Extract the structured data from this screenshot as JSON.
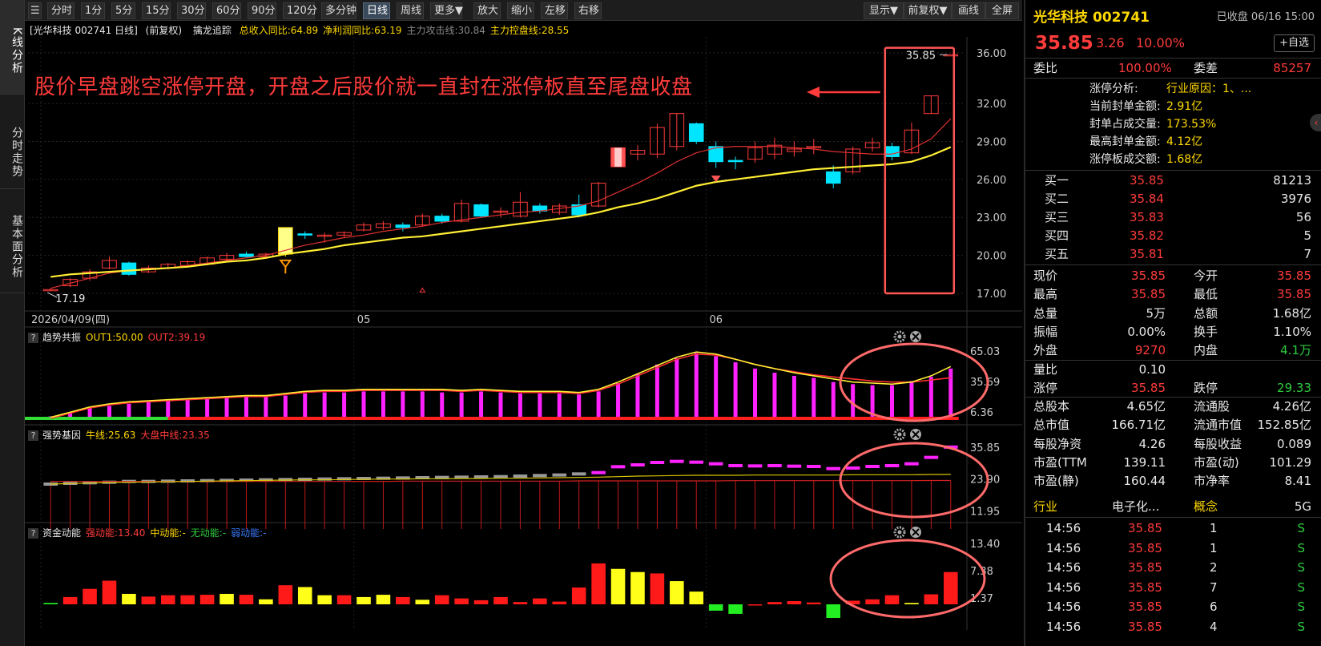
{
  "left_tabs": [
    "K线分析",
    "分时走势",
    "基本面分析"
  ],
  "toolbar": {
    "periods": [
      "分时",
      "1分",
      "5分",
      "15分",
      "30分",
      "60分",
      "90分",
      "120分",
      "多分钟",
      "日线",
      "周线",
      "更多▼"
    ],
    "actions": [
      "放大",
      "缩小",
      "左移",
      "右移"
    ],
    "right_actions": [
      "显示▼",
      "前复权▼",
      "画线",
      "全屏"
    ],
    "active_period": "日线"
  },
  "chart_header": {
    "title": "[光华科技 002741 日线]",
    "adjust": "(前复权)",
    "indicator": "擒龙追踪",
    "items": [
      {
        "label": "总收入同比:64.89",
        "color": "#ffd800"
      },
      {
        "label": "净利润同比:63.19",
        "color": "#ffd800"
      },
      {
        "label": "主力攻击线:30.84",
        "color": "#888888"
      },
      {
        "label": "主力控盘线:28.55",
        "color": "#ffd800"
      }
    ]
  },
  "annotation": "股价早盘跳空涨停开盘，开盘之后股价就一直封在涨停板直至尾盘收盘",
  "main_axis": {
    "ticks": [
      "36.00",
      "32.00",
      "29.00",
      "26.00",
      "23.00",
      "20.00",
      "17.00"
    ],
    "x_labels": [
      "2026/04/09(四)",
      "05",
      "06"
    ],
    "low_label": "17.19",
    "high_label": "35.85"
  },
  "panels": [
    {
      "id": "trend",
      "title": "趋势共振",
      "items": [
        {
          "label": "OUT1:50.00",
          "color": "#ffd800"
        },
        {
          "label": "OUT2:39.19",
          "color": "#ff3b3b"
        }
      ],
      "ticks": [
        "65.03",
        "35.69",
        "6.36"
      ]
    },
    {
      "id": "gene",
      "title": "强势基因",
      "items": [
        {
          "label": "牛线:25.63",
          "color": "#ffd800"
        },
        {
          "label": "大盘中线:23.35",
          "color": "#ff3b3b"
        }
      ],
      "ticks": [
        "35.85",
        "23.90",
        "11.95"
      ]
    },
    {
      "id": "fund",
      "title": "资金动能",
      "items": [
        {
          "label": "强动能:13.40",
          "color": "#ff3b3b"
        },
        {
          "label": "中动能:-",
          "color": "#ffd800"
        },
        {
          "label": "无动能:-",
          "color": "#2ecc40"
        },
        {
          "label": "弱动能:-",
          "color": "#3a7bff"
        }
      ],
      "ticks": [
        "13.40",
        "7.38",
        "1.37"
      ]
    }
  ],
  "chart_data": [
    {
      "type": "candlestick",
      "title": "光华科技 002741 日线",
      "ylim": [
        17,
        36.5
      ],
      "candles": [
        {
          "o": 17.3,
          "c": 17.3,
          "h": 17.4,
          "l": 17.19
        },
        {
          "o": 17.6,
          "c": 18.1,
          "h": 18.2,
          "l": 17.5
        },
        {
          "o": 18.2,
          "c": 18.7,
          "h": 18.9,
          "l": 18.0
        },
        {
          "o": 19.0,
          "c": 19.6,
          "h": 19.9,
          "l": 18.9
        },
        {
          "o": 19.4,
          "c": 18.5,
          "h": 19.5,
          "l": 18.4
        },
        {
          "o": 18.7,
          "c": 19.0,
          "h": 19.2,
          "l": 18.6
        },
        {
          "o": 19.0,
          "c": 19.3,
          "h": 19.4,
          "l": 18.9
        },
        {
          "o": 19.2,
          "c": 19.5,
          "h": 19.6,
          "l": 19.1
        },
        {
          "o": 19.3,
          "c": 19.8,
          "h": 19.9,
          "l": 19.2
        },
        {
          "o": 19.7,
          "c": 20.0,
          "h": 20.2,
          "l": 19.6
        },
        {
          "o": 20.1,
          "c": 19.9,
          "h": 20.3,
          "l": 19.8
        },
        {
          "o": 19.9,
          "c": 20.1,
          "h": 20.2,
          "l": 19.8
        },
        {
          "o": 22.2,
          "c": 20.1,
          "h": 22.2,
          "l": 19.9
        },
        {
          "o": 21.7,
          "c": 21.6,
          "h": 21.9,
          "l": 21.3
        },
        {
          "o": 21.5,
          "c": 21.6,
          "h": 21.8,
          "l": 21.0
        },
        {
          "o": 21.6,
          "c": 21.8,
          "h": 21.9,
          "l": 21.4
        },
        {
          "o": 22.0,
          "c": 22.4,
          "h": 22.6,
          "l": 21.9
        },
        {
          "o": 22.2,
          "c": 22.5,
          "h": 22.7,
          "l": 22.0
        },
        {
          "o": 22.4,
          "c": 22.2,
          "h": 22.6,
          "l": 21.9
        },
        {
          "o": 22.4,
          "c": 23.1,
          "h": 23.3,
          "l": 22.3
        },
        {
          "o": 23.1,
          "c": 22.7,
          "h": 23.3,
          "l": 22.5
        },
        {
          "o": 22.7,
          "c": 24.1,
          "h": 24.4,
          "l": 22.6
        },
        {
          "o": 24.0,
          "c": 23.1,
          "h": 24.1,
          "l": 23.0
        },
        {
          "o": 23.4,
          "c": 23.5,
          "h": 23.8,
          "l": 23.0
        },
        {
          "o": 23.1,
          "c": 24.2,
          "h": 25.0,
          "l": 23.0
        },
        {
          "o": 23.9,
          "c": 23.5,
          "h": 24.1,
          "l": 23.3
        },
        {
          "o": 23.4,
          "c": 23.9,
          "h": 24.1,
          "l": 23.2
        },
        {
          "o": 24.0,
          "c": 23.2,
          "h": 24.8,
          "l": 23.0
        },
        {
          "o": 23.9,
          "c": 25.7,
          "h": 25.8,
          "l": 23.8
        },
        {
          "o": 27.0,
          "c": 28.5,
          "h": 28.5,
          "l": 27.0
        },
        {
          "o": 28.0,
          "c": 28.3,
          "h": 28.7,
          "l": 27.5
        },
        {
          "o": 28.0,
          "c": 30.1,
          "h": 30.4,
          "l": 27.7
        },
        {
          "o": 28.6,
          "c": 31.2,
          "h": 31.2,
          "l": 28.3
        },
        {
          "o": 30.4,
          "c": 29.0,
          "h": 30.5,
          "l": 28.8
        },
        {
          "o": 28.6,
          "c": 27.4,
          "h": 29.0,
          "l": 26.9
        },
        {
          "o": 27.5,
          "c": 27.4,
          "h": 27.8,
          "l": 26.8
        },
        {
          "o": 27.6,
          "c": 28.5,
          "h": 29.0,
          "l": 27.3
        },
        {
          "o": 28.0,
          "c": 28.7,
          "h": 29.3,
          "l": 27.6
        },
        {
          "o": 28.2,
          "c": 28.4,
          "h": 29.0,
          "l": 27.8
        },
        {
          "o": 28.5,
          "c": 28.6,
          "h": 29.2,
          "l": 28.0
        },
        {
          "o": 26.6,
          "c": 25.7,
          "h": 27.1,
          "l": 25.3
        },
        {
          "o": 26.6,
          "c": 28.4,
          "h": 28.6,
          "l": 26.4
        },
        {
          "o": 28.5,
          "c": 28.9,
          "h": 29.3,
          "l": 28.2
        },
        {
          "o": 28.6,
          "c": 27.8,
          "h": 28.9,
          "l": 27.5
        },
        {
          "o": 28.1,
          "c": 29.9,
          "h": 30.5,
          "l": 28.0
        },
        {
          "o": 31.2,
          "c": 32.6,
          "h": 32.6,
          "l": 31.2
        },
        {
          "o": 35.85,
          "c": 35.85,
          "h": 35.85,
          "l": 35.85
        }
      ],
      "ma_red": [
        17.4,
        17.8,
        18.2,
        18.6,
        18.8,
        18.9,
        19.0,
        19.2,
        19.4,
        19.6,
        19.8,
        20.0,
        20.4,
        20.8,
        21.1,
        21.4,
        21.6,
        21.9,
        22.1,
        22.3,
        22.6,
        22.8,
        23.0,
        23.2,
        23.4,
        23.5,
        23.7,
        23.9,
        24.3,
        25.0,
        25.7,
        26.5,
        27.4,
        28.1,
        28.5,
        28.6,
        28.6,
        28.6,
        28.5,
        28.4,
        28.2,
        28.1,
        28.0,
        28.0,
        28.4,
        29.2,
        30.8
      ],
      "ma_yellow": [
        18.3,
        18.5,
        18.6,
        18.7,
        18.8,
        18.9,
        19.0,
        19.1,
        19.3,
        19.5,
        19.6,
        19.8,
        20.1,
        20.3,
        20.5,
        20.8,
        21.0,
        21.2,
        21.4,
        21.5,
        21.7,
        21.9,
        22.1,
        22.3,
        22.5,
        22.7,
        22.9,
        23.1,
        23.4,
        23.8,
        24.1,
        24.5,
        25.0,
        25.5,
        25.8,
        26.0,
        26.2,
        26.4,
        26.6,
        26.8,
        26.9,
        27.0,
        27.1,
        27.2,
        27.4,
        27.9,
        28.55
      ]
    },
    {
      "type": "bar",
      "title": "趋势共振",
      "ylim": [
        0,
        68
      ],
      "values": [
        2,
        6,
        10,
        12,
        14,
        16,
        18,
        19,
        20,
        20,
        21,
        21,
        22,
        24,
        25,
        25,
        26,
        26,
        26,
        26,
        25,
        25,
        26,
        25,
        24,
        24,
        24,
        23,
        26,
        34,
        43,
        52,
        58,
        63,
        60,
        54,
        48,
        44,
        41,
        39,
        35,
        33,
        32,
        32,
        36,
        40,
        48
      ],
      "out1": [
        1,
        6,
        11,
        14,
        16,
        17,
        18,
        19,
        20,
        21,
        22,
        22,
        24,
        26,
        27,
        27,
        28,
        28,
        28,
        28,
        28,
        27,
        28,
        27,
        26,
        26,
        26,
        25,
        28,
        35,
        43,
        51,
        59,
        64,
        62,
        57,
        52,
        48,
        44,
        41,
        38,
        35,
        34,
        33,
        35,
        41,
        50
      ],
      "out2": [
        0,
        5,
        10,
        13,
        15,
        16,
        17,
        18,
        19,
        20,
        21,
        21,
        23,
        25,
        26,
        26,
        27,
        27,
        27,
        27,
        27,
        26,
        27,
        26,
        25,
        25,
        25,
        24,
        27,
        33,
        41,
        49,
        57,
        62,
        61,
        57,
        52,
        48,
        45,
        42,
        40,
        38,
        36,
        35,
        35,
        37,
        39.19
      ]
    },
    {
      "type": "bar",
      "title": "强势基因",
      "ylim": [
        0,
        37
      ],
      "values": [
        22,
        22.3,
        22.5,
        22.7,
        23,
        23,
        23.1,
        23.2,
        23.3,
        23.4,
        23.5,
        23.6,
        23.7,
        23.8,
        23.9,
        24,
        24.1,
        24.2,
        24.3,
        24.4,
        24.5,
        24.6,
        24.7,
        24.8,
        25,
        25.2,
        25.4,
        25.8,
        26.3,
        28.5,
        29.2,
        30.1,
        30.5,
        30.2,
        29.6,
        28.9,
        28.8,
        28.9,
        28.7,
        28.6,
        27.8,
        28.0,
        28.6,
        28.9,
        29.6,
        32.0,
        35.85
      ],
      "niu_line": [
        22,
        22.2,
        22.4,
        22.6,
        22.7,
        22.8,
        22.9,
        23.0,
        23.1,
        23.2,
        23.3,
        23.4,
        23.5,
        23.6,
        23.6,
        23.7,
        23.8,
        23.9,
        23.9,
        24.0,
        24.0,
        24.1,
        24.1,
        24.2,
        24.2,
        24.3,
        24.4,
        24.5,
        24.6,
        24.8,
        25.0,
        25.1,
        25.2,
        25.3,
        25.3,
        25.3,
        25.4,
        25.4,
        25.4,
        25.4,
        25.4,
        25.5,
        25.5,
        25.5,
        25.5,
        25.6,
        25.63
      ],
      "dapan": [
        23.0,
        23.0,
        23.0,
        23.0,
        23.0,
        23.0,
        23.0,
        23.0,
        23.0,
        23.0,
        23.0,
        23.0,
        23.0,
        23.0,
        23.0,
        23.0,
        23.0,
        23.0,
        23.1,
        23.1,
        23.1,
        23.1,
        23.1,
        23.1,
        23.1,
        23.1,
        23.1,
        23.2,
        23.2,
        23.2,
        23.2,
        23.2,
        23.2,
        23.2,
        23.2,
        23.3,
        23.3,
        23.3,
        23.3,
        23.3,
        23.3,
        23.3,
        23.3,
        23.3,
        23.3,
        23.35,
        23.35
      ]
    },
    {
      "type": "bar",
      "title": "资金动能",
      "ylim": [
        -4,
        14
      ],
      "values": [
        0.3,
        1.6,
        3.4,
        5.2,
        2.3,
        1.7,
        2.0,
        2.0,
        2.1,
        2.3,
        2.1,
        1.1,
        4.2,
        3.8,
        2.0,
        2.0,
        1.6,
        2.1,
        1.6,
        1.0,
        2.0,
        1.3,
        0.9,
        1.6,
        0.5,
        1.3,
        0.6,
        3.7,
        9.0,
        7.8,
        7.1,
        6.8,
        5.1,
        2.8,
        -1.4,
        -2.1,
        -0.2,
        0.5,
        0.7,
        0.4,
        -3.0,
        0.8,
        1.1,
        2.0,
        0.3,
        2.2,
        7.1,
        13.4
      ],
      "colors": [
        "g",
        "r",
        "r",
        "r",
        "y",
        "r",
        "r",
        "r",
        "r",
        "y",
        "r",
        "y",
        "r",
        "y",
        "y",
        "r",
        "y",
        "y",
        "r",
        "y",
        "r",
        "r",
        "r",
        "r",
        "r",
        "r",
        "r",
        "r",
        "r",
        "y",
        "y",
        "r",
        "y",
        "y",
        "g",
        "g",
        "r",
        "r",
        "r",
        "r",
        "g",
        "r",
        "r",
        "r",
        "y",
        "r",
        "r",
        "r"
      ]
    }
  ],
  "quote": {
    "name": "光华科技",
    "code": "002741",
    "status": "已收盘 06/16 15:00",
    "price": "35.85",
    "change": "3.26",
    "pct": "10.00%",
    "add_button": "+自选",
    "weibi_label": "委比",
    "weibi": "100.00%",
    "weicha_label": "委差",
    "weicha": "85257",
    "limit_rows": [
      {
        "label": "涨停分析:",
        "value": "行业原因：1、..."
      },
      {
        "label": "当前封单金额:",
        "value": "2.91亿"
      },
      {
        "label": "封单占成交量:",
        "value": "173.53%"
      },
      {
        "label": "最高封单金额:",
        "value": "4.12亿"
      },
      {
        "label": "涨停板成交额:",
        "value": "1.68亿"
      }
    ],
    "buy_rows": [
      {
        "label": "买一",
        "price": "35.85",
        "vol": "81213"
      },
      {
        "label": "买二",
        "price": "35.84",
        "vol": "3976"
      },
      {
        "label": "买三",
        "price": "35.83",
        "vol": "56"
      },
      {
        "label": "买四",
        "price": "35.82",
        "vol": "5"
      },
      {
        "label": "买五",
        "price": "35.81",
        "vol": "7"
      }
    ],
    "stats": [
      {
        "l1": "现价",
        "v1": "35.85",
        "c1": "red",
        "l2": "今开",
        "v2": "35.85",
        "c2": "red"
      },
      {
        "l1": "最高",
        "v1": "35.85",
        "c1": "red",
        "l2": "最低",
        "v2": "35.85",
        "c2": "red"
      },
      {
        "l1": "总量",
        "v1": "5万",
        "c1": "white",
        "l2": "总额",
        "v2": "1.68亿",
        "c2": "white"
      },
      {
        "l1": "振幅",
        "v1": "0.00%",
        "c1": "white",
        "l2": "换手",
        "v2": "1.10%",
        "c2": "white"
      },
      {
        "l1": "外盘",
        "v1": "9270",
        "c1": "red",
        "l2": "内盘",
        "v2": "4.1万",
        "c2": "green"
      },
      {
        "l1": "量比",
        "v1": "0.10",
        "c1": "white",
        "l2": "",
        "v2": "",
        "c2": "white"
      },
      {
        "l1": "涨停",
        "v1": "35.85",
        "c1": "red",
        "l2": "跌停",
        "v2": "29.33",
        "c2": "green"
      },
      {
        "l1": "总股本",
        "v1": "4.65亿",
        "c1": "white",
        "l2": "流通股",
        "v2": "4.26亿",
        "c2": "white"
      },
      {
        "l1": "总市值",
        "v1": "166.71亿",
        "c1": "white",
        "l2": "流通市值",
        "v2": "152.85亿",
        "c2": "white"
      },
      {
        "l1": "每股净资",
        "v1": "4.26",
        "c1": "white",
        "l2": "每股收益",
        "v2": "0.089",
        "c2": "white"
      },
      {
        "l1": "市盈(TTM",
        "v1": "139.11",
        "c1": "white",
        "l2": "市盈(动)",
        "v2": "101.29",
        "c2": "white"
      },
      {
        "l1": "市盈(静)",
        "v1": "160.44",
        "c1": "white",
        "l2": "市净率",
        "v2": "8.41",
        "c2": "white"
      }
    ],
    "industry_label": "行业",
    "industry": "电子化...",
    "concept_label": "概念",
    "concept": "5G",
    "ticks": [
      {
        "t": "14:56",
        "p": "35.85",
        "v": "1",
        "s": "S"
      },
      {
        "t": "14:56",
        "p": "35.85",
        "v": "1",
        "s": "S"
      },
      {
        "t": "14:56",
        "p": "35.85",
        "v": "2",
        "s": "S"
      },
      {
        "t": "14:56",
        "p": "35.85",
        "v": "7",
        "s": "S"
      },
      {
        "t": "14:56",
        "p": "35.85",
        "v": "6",
        "s": "S"
      },
      {
        "t": "14:56",
        "p": "35.85",
        "v": "4",
        "s": "S"
      }
    ]
  }
}
